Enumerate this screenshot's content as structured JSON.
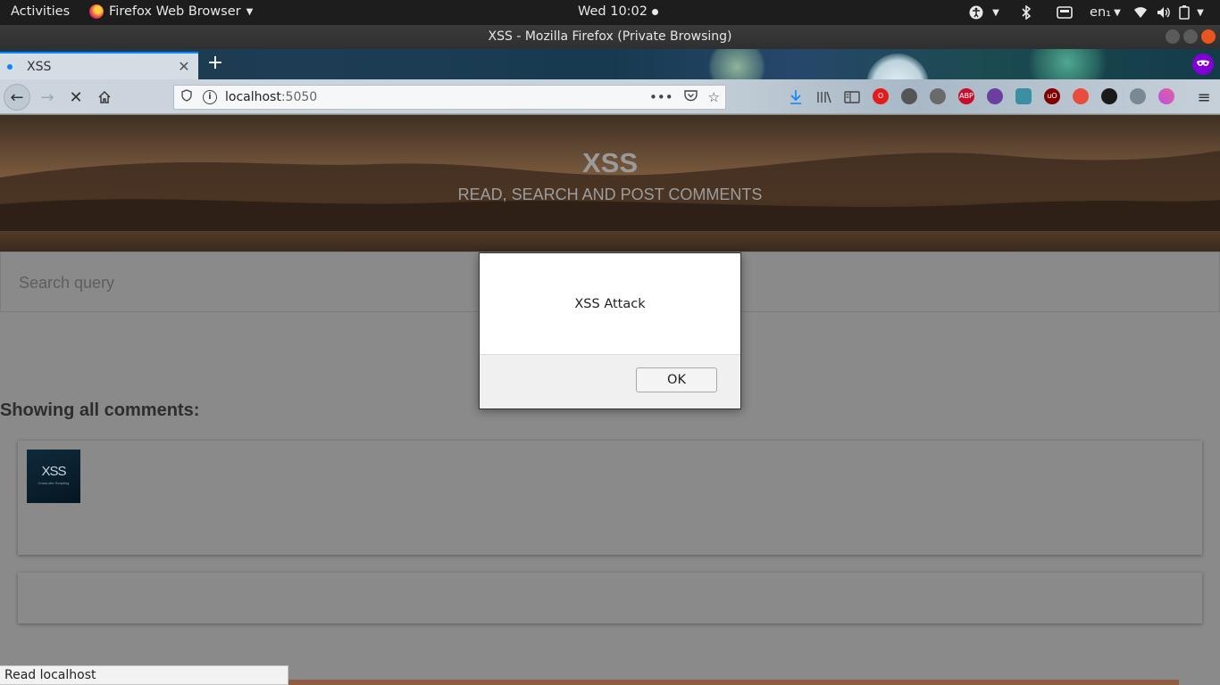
{
  "system": {
    "activities": "Activities",
    "app_menu": "Firefox Web Browser",
    "clock": "Wed 10:02",
    "keyboard_layout": "en₁"
  },
  "window": {
    "title": "XSS - Mozilla Firefox (Private Browsing)"
  },
  "browser": {
    "tab": {
      "title": "XSS"
    },
    "url": {
      "host": "localhost",
      "port": ":5050"
    },
    "icons": [
      "back-icon",
      "forward-icon",
      "stop-icon",
      "home-icon",
      "shield-icon",
      "info-icon",
      "more-icon",
      "pocket-icon",
      "star-icon",
      "download-icon",
      "library-icon",
      "sidebar-icon",
      "menu-icon"
    ],
    "accent_color": "#0a84ff",
    "private_color": "#8000d7"
  },
  "page": {
    "hero_title": "XSS",
    "hero_subtitle": "READ, SEARCH AND POST COMMENTS",
    "search_placeholder": "Search query",
    "showing_label": "Showing all comments:",
    "comment_thumb_title": "XSS",
    "comment_thumb_caption": "Cross-site Scripting"
  },
  "dialog": {
    "message": "XSS Attack",
    "ok_label": "OK"
  },
  "status_bar": {
    "text": "Read localhost"
  }
}
